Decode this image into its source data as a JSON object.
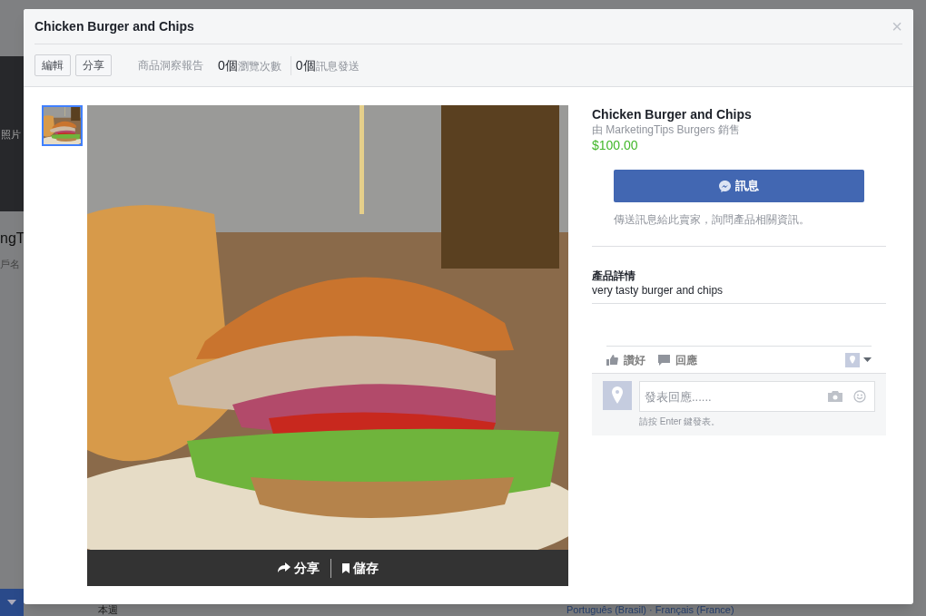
{
  "background": {
    "photo_label": "照片",
    "name_fragment": "ngT",
    "subtitle_fragment": "戶名",
    "week_label": "本週",
    "languages": "Português (Brasil) · Français (France)"
  },
  "dialog": {
    "title": "Chicken Burger and Chips",
    "close": "×",
    "toolbar": {
      "buttons": [
        "編輯",
        "分享"
      ],
      "insights_label": "商品洞察報告",
      "stats": [
        {
          "count": "0個",
          "label": "瀏覽次數"
        },
        {
          "count": "0個",
          "label": "訊息發送"
        }
      ]
    },
    "thumbnails": [
      {
        "selected": true
      }
    ],
    "photo_actions": [
      {
        "kind": "share",
        "label": "分享"
      },
      {
        "kind": "save",
        "label": "儲存"
      }
    ],
    "product": {
      "name": "Chicken Burger and Chips",
      "seller": "由 MarketingTips Burgers 銷售",
      "price": "$100.00",
      "message_button": "訊息",
      "message_hint": "傳送訊息給此賣家，詢問產品相關資訊。",
      "details_heading": "產品詳情",
      "details": "very tasty burger and chips"
    },
    "reactions": [
      {
        "kind": "like",
        "label": "讚好"
      },
      {
        "kind": "comment",
        "label": "回應"
      }
    ],
    "comment": {
      "placeholder": "發表回應......",
      "hint": "請按 Enter 鍵發表。"
    }
  }
}
